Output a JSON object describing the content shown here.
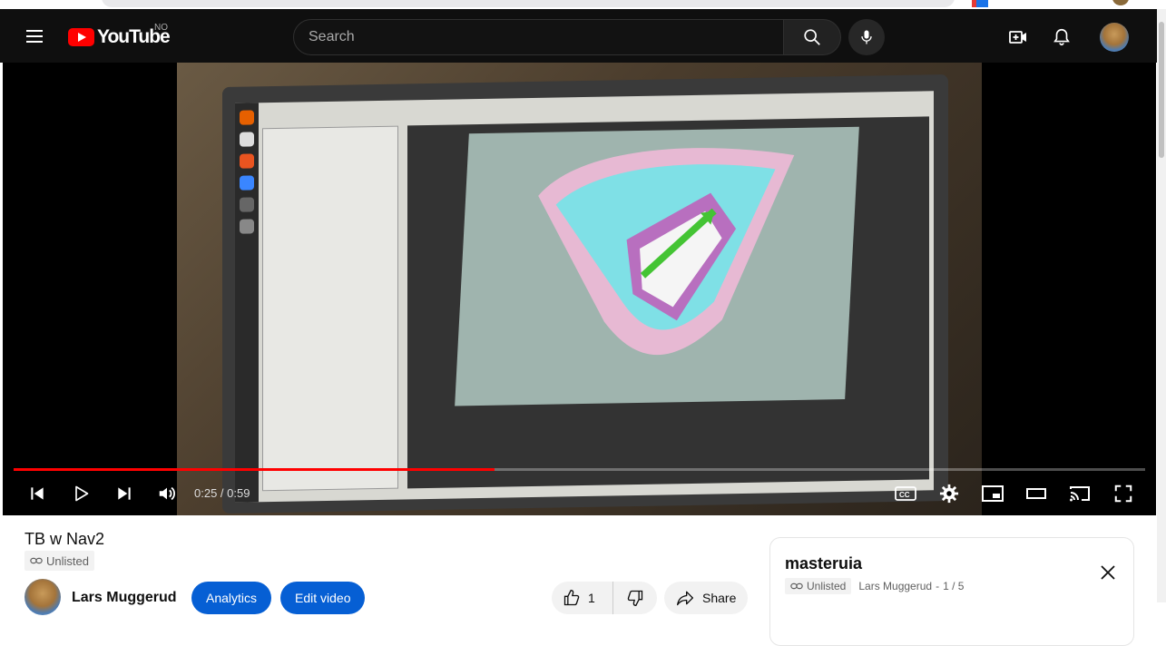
{
  "masthead": {
    "logo_text": "YouTube",
    "country_code": "NO",
    "search_placeholder": "Search"
  },
  "player": {
    "current_time": "0:25",
    "duration": "0:59",
    "time_separator": " / ",
    "progress_fraction": 0.425
  },
  "video": {
    "title": "TB w Nav2",
    "visibility": "Unlisted"
  },
  "channel": {
    "name": "Lars Muggerud"
  },
  "actions": {
    "analytics_label": "Analytics",
    "edit_label": "Edit video",
    "like_count": "1",
    "share_label": "Share"
  },
  "playlist": {
    "title": "masteruia",
    "visibility": "Unlisted",
    "owner": "Lars Muggerud",
    "position": "1 / 5",
    "separator": "-"
  },
  "colors": {
    "youtube_red": "#ff0000",
    "blue_button": "#065fd4",
    "masthead_bg": "#0f0f0f"
  }
}
